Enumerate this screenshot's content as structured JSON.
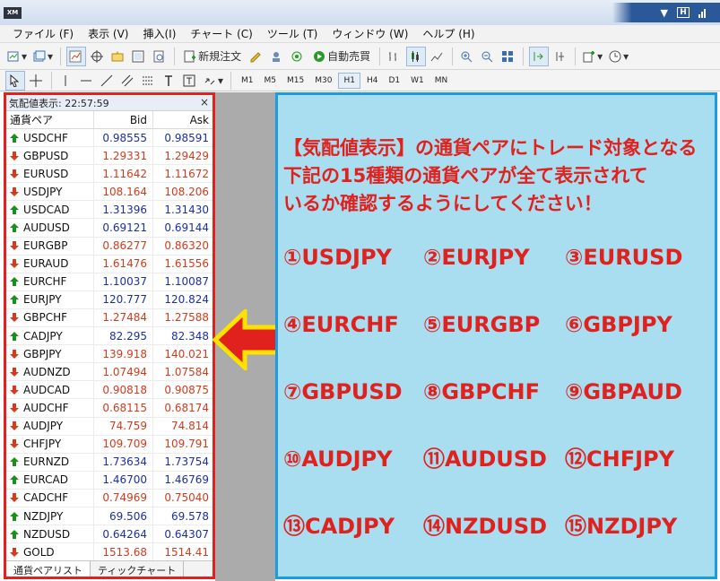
{
  "titlebar": {
    "logo": "XM"
  },
  "menu": [
    "ファイル (F)",
    "表示 (V)",
    "挿入(I)",
    "チャート (C)",
    "ツール (T)",
    "ウィンドウ (W)",
    "ヘルプ (H)"
  ],
  "toolbar": {
    "new_order": "新規注文",
    "auto_trade": "自動売買"
  },
  "timeframes": [
    "M1",
    "M5",
    "M15",
    "M30",
    "H1",
    "H4",
    "D1",
    "W1",
    "MN"
  ],
  "active_timeframe": "H1",
  "market_watch": {
    "title": "気配値表示: 22:57:59",
    "close": "×",
    "columns": {
      "symbol": "通貨ペア",
      "bid": "Bid",
      "ask": "Ask"
    },
    "rows": [
      {
        "symbol": "USDCHF",
        "bid": "0.98555",
        "ask": "0.98591",
        "dir": "up"
      },
      {
        "symbol": "GBPUSD",
        "bid": "1.29331",
        "ask": "1.29429",
        "dir": "down"
      },
      {
        "symbol": "EURUSD",
        "bid": "1.11642",
        "ask": "1.11672",
        "dir": "down"
      },
      {
        "symbol": "USDJPY",
        "bid": "108.164",
        "ask": "108.206",
        "dir": "down"
      },
      {
        "symbol": "USDCAD",
        "bid": "1.31396",
        "ask": "1.31430",
        "dir": "up"
      },
      {
        "symbol": "AUDUSD",
        "bid": "0.69121",
        "ask": "0.69144",
        "dir": "up"
      },
      {
        "symbol": "EURGBP",
        "bid": "0.86277",
        "ask": "0.86320",
        "dir": "down"
      },
      {
        "symbol": "EURAUD",
        "bid": "1.61476",
        "ask": "1.61556",
        "dir": "down"
      },
      {
        "symbol": "EURCHF",
        "bid": "1.10037",
        "ask": "1.10087",
        "dir": "up"
      },
      {
        "symbol": "EURJPY",
        "bid": "120.777",
        "ask": "120.824",
        "dir": "up"
      },
      {
        "symbol": "GBPCHF",
        "bid": "1.27484",
        "ask": "1.27588",
        "dir": "down"
      },
      {
        "symbol": "CADJPY",
        "bid": "82.295",
        "ask": "82.348",
        "dir": "up"
      },
      {
        "symbol": "GBPJPY",
        "bid": "139.918",
        "ask": "140.021",
        "dir": "down"
      },
      {
        "symbol": "AUDNZD",
        "bid": "1.07494",
        "ask": "1.07584",
        "dir": "down"
      },
      {
        "symbol": "AUDCAD",
        "bid": "0.90818",
        "ask": "0.90875",
        "dir": "down"
      },
      {
        "symbol": "AUDCHF",
        "bid": "0.68115",
        "ask": "0.68174",
        "dir": "down"
      },
      {
        "symbol": "AUDJPY",
        "bid": "74.759",
        "ask": "74.814",
        "dir": "down"
      },
      {
        "symbol": "CHFJPY",
        "bid": "109.709",
        "ask": "109.791",
        "dir": "down"
      },
      {
        "symbol": "EURNZD",
        "bid": "1.73634",
        "ask": "1.73754",
        "dir": "up"
      },
      {
        "symbol": "EURCAD",
        "bid": "1.46700",
        "ask": "1.46769",
        "dir": "up"
      },
      {
        "symbol": "CADCHF",
        "bid": "0.74969",
        "ask": "0.75040",
        "dir": "down"
      },
      {
        "symbol": "NZDJPY",
        "bid": "69.506",
        "ask": "69.578",
        "dir": "up"
      },
      {
        "symbol": "NZDUSD",
        "bid": "0.64264",
        "ask": "0.64307",
        "dir": "up"
      },
      {
        "symbol": "GOLD",
        "bid": "1513.68",
        "ask": "1514.41",
        "dir": "down"
      }
    ],
    "tabs": [
      "通貨ペアリスト",
      "ティックチャート"
    ]
  },
  "note": {
    "lines": [
      "【気配値表示】の通貨ペアにトレード対象となる",
      "下記の15種類の通貨ペアが全て表示されて",
      "いるか確認するようにしてください！"
    ],
    "pairs": [
      "①USDJPY",
      "②EURJPY",
      "③EURUSD",
      "④EURCHF",
      "⑤EURGBP",
      "⑥GBPJPY",
      "⑦GBPUSD",
      "⑧GBPCHF",
      "⑨GBPAUD",
      "⑩AUDJPY",
      "⑪AUDUSD",
      "⑫CHFJPY",
      "⑬CADJPY",
      "⑭NZDUSD",
      "⑮NZDJPY"
    ]
  },
  "colors": {
    "up": "#1a8f1a",
    "down": "#d43a1c",
    "bid_text": "#1b2fa8",
    "ask_text": "#1b2fa8",
    "highlight_red": "#e0211d",
    "highlight_blue": "#1b9ce2",
    "arrow_yellow": "#ffe200"
  }
}
